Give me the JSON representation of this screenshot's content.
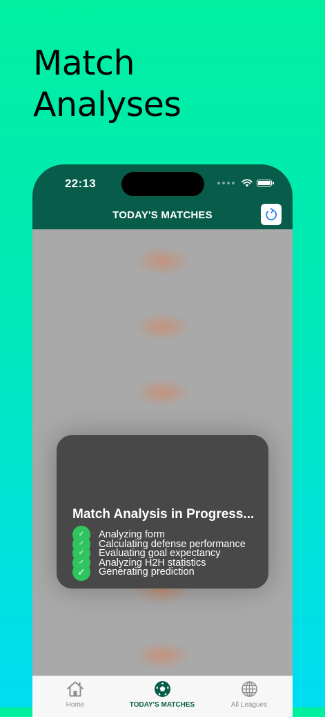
{
  "promo": {
    "line1": "Match",
    "line2": "Analyses"
  },
  "status_bar": {
    "time": "22:13"
  },
  "header": {
    "title": "TODAY'S MATCHES"
  },
  "icons": {
    "refresh": "refresh-icon",
    "home": "house-icon",
    "matches": "soccer-ball-icon",
    "leagues": "globe-icon",
    "check": "checkmark-icon"
  },
  "colors": {
    "header_bg": "#075d49",
    "check_green": "#2fc45e",
    "hud_bg": "#484848",
    "accent_blue": "#1a7cf0"
  },
  "hud": {
    "title": "Match Analysis in Progress...",
    "steps": [
      {
        "label": "Analyzing form",
        "mark": "✓"
      },
      {
        "label": "Calculating defense performance",
        "mark": "✓"
      },
      {
        "label": "Evaluating goal expectancy",
        "mark": "✓"
      },
      {
        "label": "Analyzing H2H statistics",
        "mark": "✓"
      },
      {
        "label": "Generating prediction",
        "mark": "✓"
      }
    ]
  },
  "tabbar": {
    "tabs": [
      {
        "label": "Home",
        "active": false
      },
      {
        "label": "TODAY'S MATCHES",
        "active": true
      },
      {
        "label": "All Leagues",
        "active": false
      }
    ]
  }
}
